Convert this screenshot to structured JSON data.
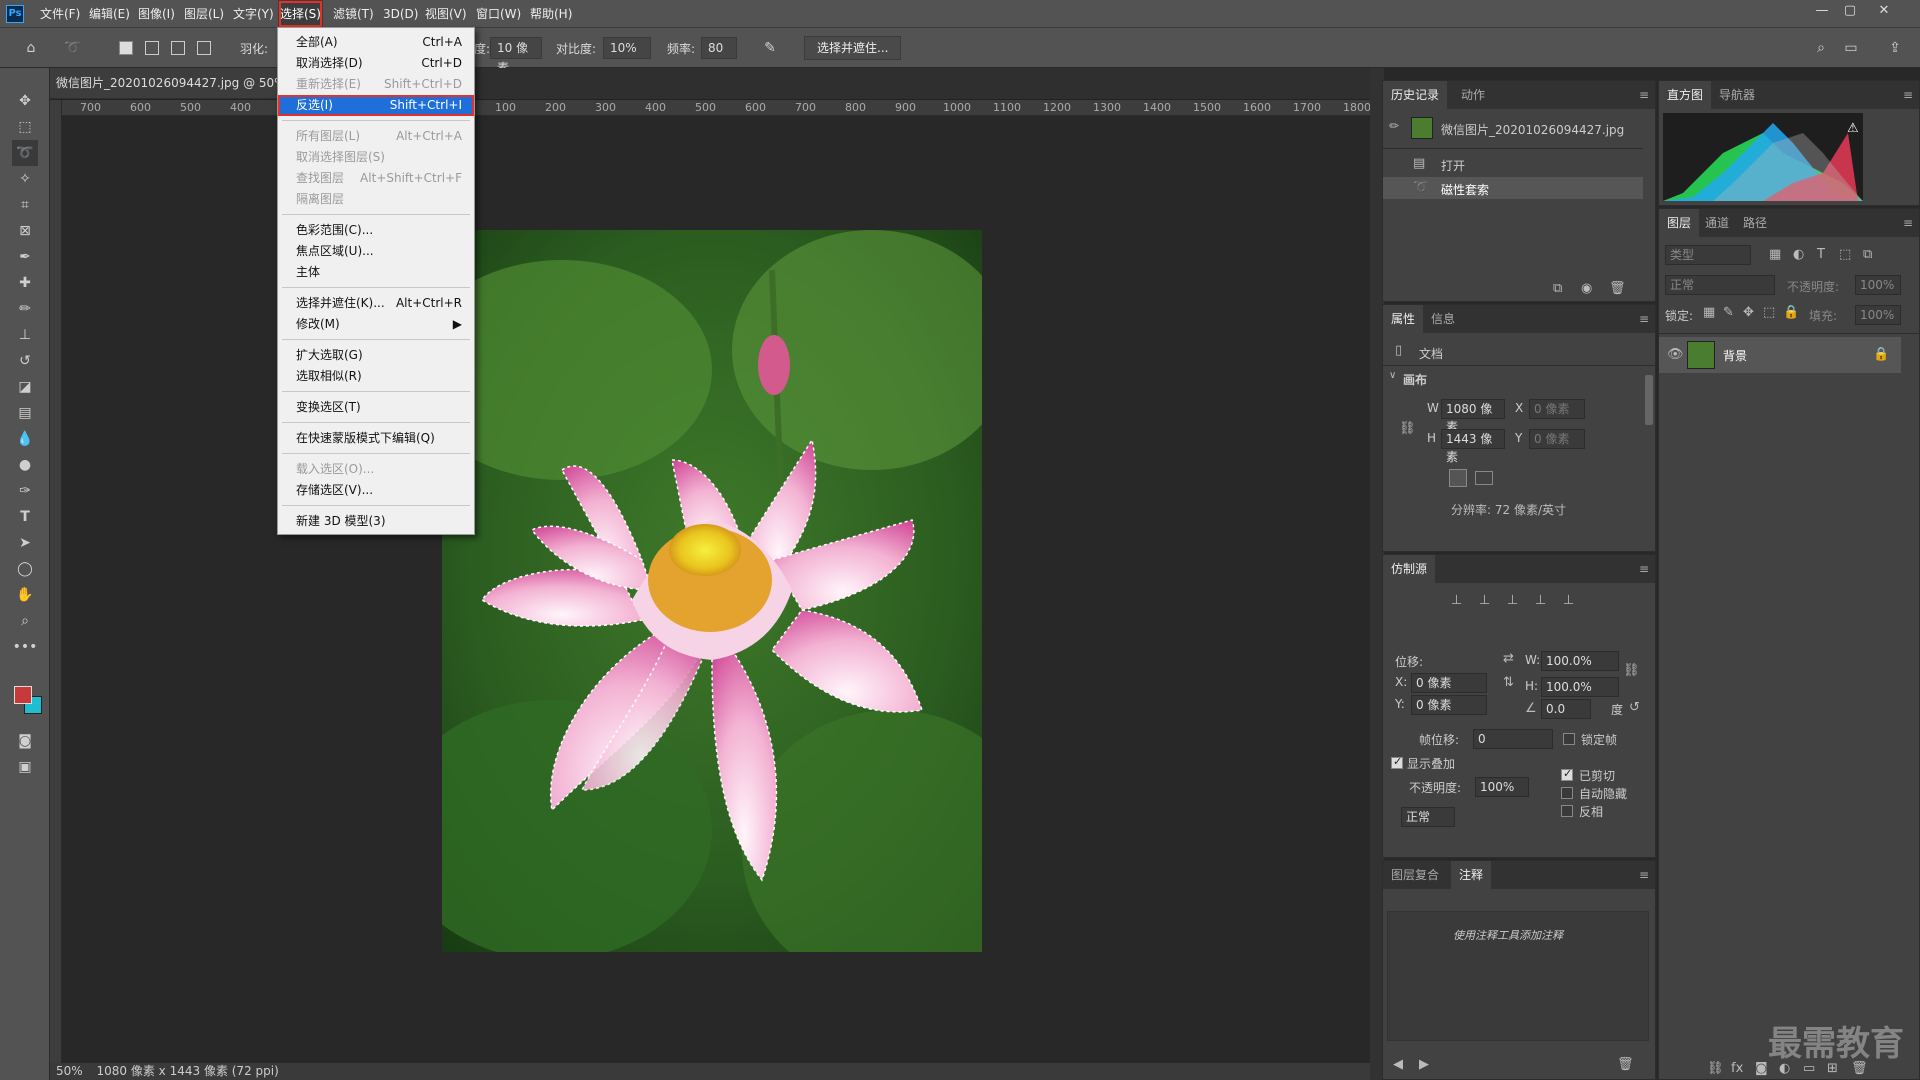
{
  "menubar": {
    "logo": "Ps",
    "items": [
      "文件(F)",
      "编辑(E)",
      "图像(I)",
      "图层(L)",
      "文字(Y)",
      "选择(S)",
      "滤镜(T)",
      "3D(D)",
      "视图(V)",
      "窗口(W)",
      "帮助(H)"
    ],
    "active_index": 5
  },
  "options": {
    "feather_label": "羽化:",
    "width_label": "宽度:",
    "width_value": "10 像素",
    "contrast_label": "对比度:",
    "contrast_value": "10%",
    "frequency_label": "频率:",
    "frequency_value": "80",
    "select_mask_button": "选择并遮住..."
  },
  "document": {
    "tab_title": "微信图片_20201026094427.jpg @ 50%",
    "status_zoom": "50%",
    "status_info": "1080 像素 x 1443 像素 (72 ppi)",
    "ruler_ticks": [
      "700",
      "600",
      "500",
      "400",
      "100",
      "200",
      "300",
      "400",
      "500",
      "600",
      "700",
      "800",
      "900",
      "1000",
      "1100",
      "1200",
      "1300",
      "1400",
      "1500",
      "1600",
      "1700",
      "1800"
    ]
  },
  "select_menu": {
    "items": [
      {
        "label": "全部(A)",
        "shortcut": "Ctrl+A",
        "disabled": false
      },
      {
        "label": "取消选择(D)",
        "shortcut": "Ctrl+D",
        "disabled": false
      },
      {
        "label": "重新选择(E)",
        "shortcut": "Shift+Ctrl+D",
        "disabled": true
      },
      {
        "label": "反选(I)",
        "shortcut": "Shift+Ctrl+I",
        "disabled": false,
        "selected": true
      },
      {
        "label": "所有图层(L)",
        "shortcut": "Alt+Ctrl+A",
        "disabled": true
      },
      {
        "label": "取消选择图层(S)",
        "shortcut": "",
        "disabled": true
      },
      {
        "label": "查找图层",
        "shortcut": "Alt+Shift+Ctrl+F",
        "disabled": true
      },
      {
        "label": "隔离图层",
        "shortcut": "",
        "disabled": true
      },
      {
        "label": "色彩范围(C)...",
        "shortcut": "",
        "disabled": false
      },
      {
        "label": "焦点区域(U)...",
        "shortcut": "",
        "disabled": false
      },
      {
        "label": "主体",
        "shortcut": "",
        "disabled": false
      },
      {
        "label": "选择并遮住(K)...",
        "shortcut": "Alt+Ctrl+R",
        "disabled": false
      },
      {
        "label": "修改(M)",
        "shortcut": "",
        "disabled": false,
        "submenu": true
      },
      {
        "label": "扩大选取(G)",
        "shortcut": "",
        "disabled": false
      },
      {
        "label": "选取相似(R)",
        "shortcut": "",
        "disabled": false
      },
      {
        "label": "变换选区(T)",
        "shortcut": "",
        "disabled": false
      },
      {
        "label": "在快速蒙版模式下编辑(Q)",
        "shortcut": "",
        "disabled": false
      },
      {
        "label": "载入选区(O)...",
        "shortcut": "",
        "disabled": true
      },
      {
        "label": "存储选区(V)...",
        "shortcut": "",
        "disabled": false
      },
      {
        "label": "新建 3D 模型(3)",
        "shortcut": "",
        "disabled": false
      }
    ]
  },
  "history_panel": {
    "tabs": [
      "历史记录",
      "动作"
    ],
    "snapshot": "微信图片_20201026094427.jpg",
    "steps": [
      "打开",
      "磁性套索"
    ]
  },
  "properties_panel": {
    "tabs": [
      "属性",
      "信息"
    ],
    "doc_label": "文档",
    "canvas_label": "画布",
    "w_label": "W",
    "w_value": "1080 像素",
    "h_label": "H",
    "h_value": "1443 像素",
    "x_label": "X",
    "x_placeholder": "0 像素",
    "y_label": "Y",
    "y_placeholder": "0 像素",
    "resolution": "分辨率: 72 像素/英寸"
  },
  "clone_panel": {
    "title": "仿制源",
    "offset_label": "位移:",
    "x_label": "X:",
    "x_value": "0 像素",
    "y_label": "Y:",
    "y_value": "0 像素",
    "w_label": "W:",
    "w_value": "100.0%",
    "h_label": "H:",
    "h_value": "100.0%",
    "angle_value": "0.0",
    "degree_label": "度",
    "frame_offset_label": "帧位移:",
    "frame_offset_value": "0",
    "lock_frame_label": "锁定帧",
    "show_overlay_label": "显示叠加",
    "opacity_label": "不透明度:",
    "opacity_value": "100%",
    "clipped_label": "已剪切",
    "autohide_label": "自动隐藏",
    "invert_label": "反相",
    "blend_mode": "正常"
  },
  "notes_panel": {
    "tabs": [
      "图层复合",
      "注释"
    ],
    "hint": "使用注释工具添加注释"
  },
  "histogram_panel": {
    "tabs": [
      "直方图",
      "导航器"
    ]
  },
  "layers_panel": {
    "tabs": [
      "图层",
      "通道",
      "路径"
    ],
    "search_placeholder": "类型",
    "blend_mode": "正常",
    "opacity_label": "不透明度:",
    "opacity_value": "100%",
    "lock_label": "锁定:",
    "fill_label": "填充:",
    "fill_value": "100%",
    "layer_name": "背景"
  },
  "watermark": "最需教育",
  "colors": {
    "foreground": "#c83a3a",
    "background": "#1fbcd2",
    "accent": "#1e6fd9",
    "highlight_border": "#e5312a"
  }
}
